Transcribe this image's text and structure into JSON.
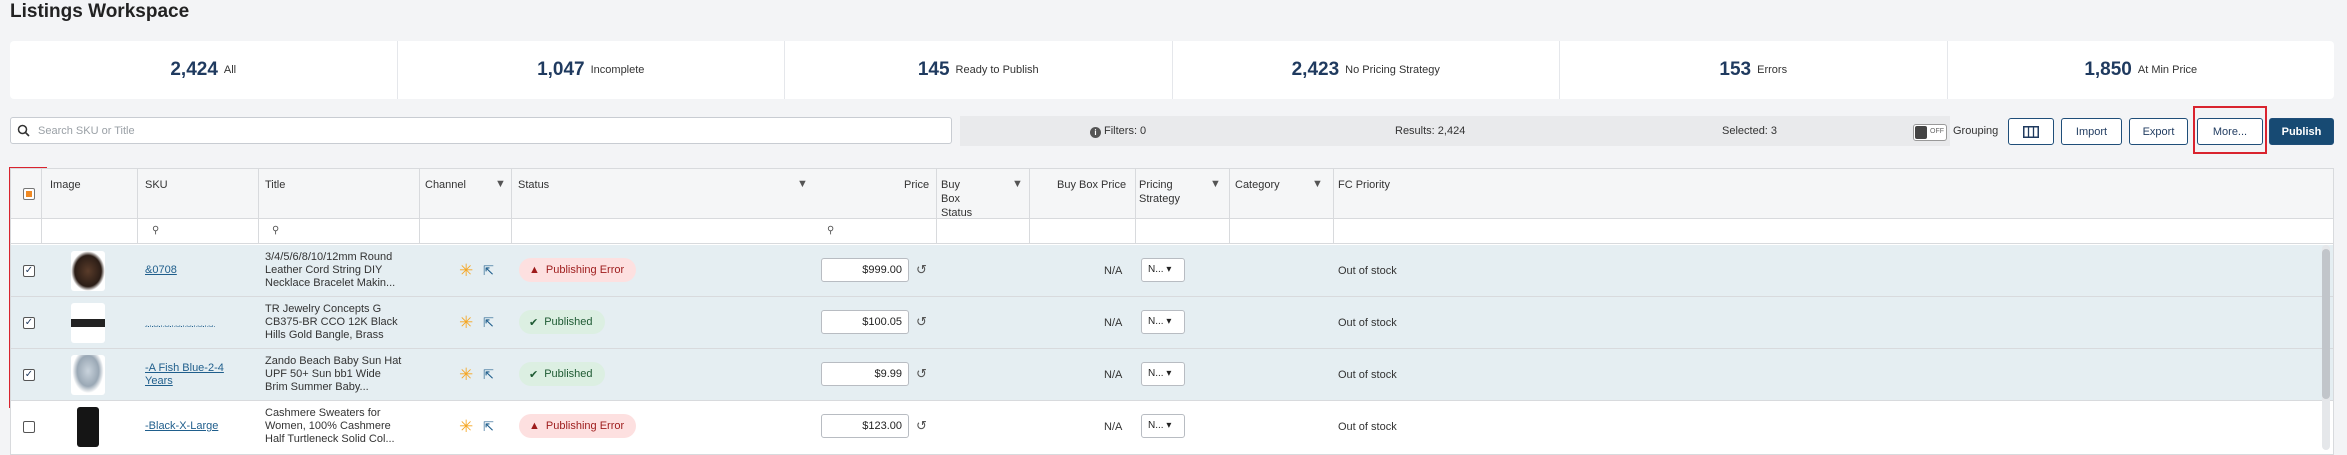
{
  "page_title": "Listings Workspace",
  "stats": [
    {
      "value": "2,424",
      "label": "All"
    },
    {
      "value": "1,047",
      "label": "Incomplete"
    },
    {
      "value": "145",
      "label": "Ready to Publish"
    },
    {
      "value": "2,423",
      "label": "No Pricing Strategy"
    },
    {
      "value": "153",
      "label": "Errors"
    },
    {
      "value": "1,850",
      "label": "At Min Price"
    }
  ],
  "search": {
    "placeholder": "Search SKU or Title"
  },
  "info": {
    "filters": "Filters: 0",
    "results": "Results: 2,424",
    "selected": "Selected: 3"
  },
  "grouping": {
    "toggle": "OFF",
    "label": "Grouping"
  },
  "buttons": {
    "import": "Import",
    "export": "Export",
    "more": "More...",
    "publish": "Publish"
  },
  "columns": {
    "image": "Image",
    "sku": "SKU",
    "title": "Title",
    "channel": "Channel",
    "status": "Status",
    "price": "Price",
    "buybox_status": "Buy Box Status",
    "buybox_price": "Buy Box Price",
    "pricing_strategy": "Pricing Strategy",
    "category": "Category",
    "fc_priority": "FC Priority"
  },
  "rows": [
    {
      "checked": true,
      "sku": "&0708",
      "title": "3/4/5/6/8/10/12mm Round Leather Cord String DIY Necklace Bracelet Makin...",
      "status": "Publishing Error",
      "status_type": "error",
      "price": "$999.00",
      "buybox_price": "N/A",
      "strategy": "N...",
      "fc": "Out of stock"
    },
    {
      "checked": true,
      "sku": "ˌˌˌˌˌˌˌˌˌˌˌˌˌˌˌˌˌˌˌ",
      "title": "TR Jewelry Concepts G CB375-BR CCO 12K Black Hills Gold Bangle, Brass",
      "status": "Published",
      "status_type": "ok",
      "price": "$100.05",
      "buybox_price": "N/A",
      "strategy": "N...",
      "fc": "Out of stock"
    },
    {
      "checked": true,
      "sku": "-A Fish Blue-2-4 Years",
      "title": "Zando Beach Baby Sun Hat UPF 50+ Sun bb1 Wide Brim Summer Baby...",
      "status": "Published",
      "status_type": "ok",
      "price": "$9.99",
      "buybox_price": "N/A",
      "strategy": "N...",
      "fc": "Out of stock"
    },
    {
      "checked": false,
      "sku": "-Black-X-Large",
      "title": "Cashmere Sweaters for Women, 100% Cashmere Half Turtleneck Solid Col...",
      "status": "Publishing Error",
      "status_type": "error",
      "price": "$123.00",
      "buybox_price": "N/A",
      "strategy": "N...",
      "fc": "Out of stock"
    }
  ]
}
